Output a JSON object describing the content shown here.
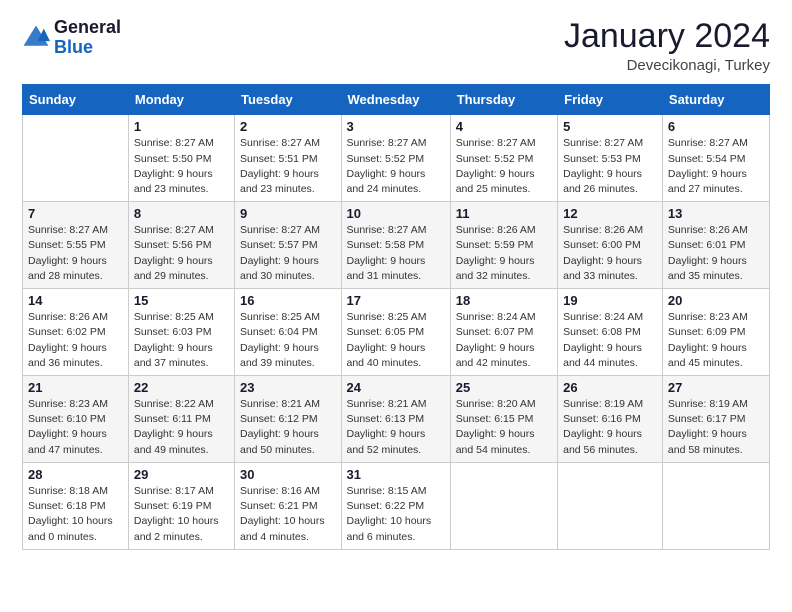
{
  "logo": {
    "general": "General",
    "blue": "Blue"
  },
  "title": "January 2024",
  "location": "Devecikonagi, Turkey",
  "weekdays": [
    "Sunday",
    "Monday",
    "Tuesday",
    "Wednesday",
    "Thursday",
    "Friday",
    "Saturday"
  ],
  "weeks": [
    [
      {
        "day": "",
        "sunrise": "",
        "sunset": "",
        "daylight": ""
      },
      {
        "day": "1",
        "sunrise": "Sunrise: 8:27 AM",
        "sunset": "Sunset: 5:50 PM",
        "daylight": "Daylight: 9 hours and 23 minutes."
      },
      {
        "day": "2",
        "sunrise": "Sunrise: 8:27 AM",
        "sunset": "Sunset: 5:51 PM",
        "daylight": "Daylight: 9 hours and 23 minutes."
      },
      {
        "day": "3",
        "sunrise": "Sunrise: 8:27 AM",
        "sunset": "Sunset: 5:52 PM",
        "daylight": "Daylight: 9 hours and 24 minutes."
      },
      {
        "day": "4",
        "sunrise": "Sunrise: 8:27 AM",
        "sunset": "Sunset: 5:52 PM",
        "daylight": "Daylight: 9 hours and 25 minutes."
      },
      {
        "day": "5",
        "sunrise": "Sunrise: 8:27 AM",
        "sunset": "Sunset: 5:53 PM",
        "daylight": "Daylight: 9 hours and 26 minutes."
      },
      {
        "day": "6",
        "sunrise": "Sunrise: 8:27 AM",
        "sunset": "Sunset: 5:54 PM",
        "daylight": "Daylight: 9 hours and 27 minutes."
      }
    ],
    [
      {
        "day": "7",
        "sunrise": "Sunrise: 8:27 AM",
        "sunset": "Sunset: 5:55 PM",
        "daylight": "Daylight: 9 hours and 28 minutes."
      },
      {
        "day": "8",
        "sunrise": "Sunrise: 8:27 AM",
        "sunset": "Sunset: 5:56 PM",
        "daylight": "Daylight: 9 hours and 29 minutes."
      },
      {
        "day": "9",
        "sunrise": "Sunrise: 8:27 AM",
        "sunset": "Sunset: 5:57 PM",
        "daylight": "Daylight: 9 hours and 30 minutes."
      },
      {
        "day": "10",
        "sunrise": "Sunrise: 8:27 AM",
        "sunset": "Sunset: 5:58 PM",
        "daylight": "Daylight: 9 hours and 31 minutes."
      },
      {
        "day": "11",
        "sunrise": "Sunrise: 8:26 AM",
        "sunset": "Sunset: 5:59 PM",
        "daylight": "Daylight: 9 hours and 32 minutes."
      },
      {
        "day": "12",
        "sunrise": "Sunrise: 8:26 AM",
        "sunset": "Sunset: 6:00 PM",
        "daylight": "Daylight: 9 hours and 33 minutes."
      },
      {
        "day": "13",
        "sunrise": "Sunrise: 8:26 AM",
        "sunset": "Sunset: 6:01 PM",
        "daylight": "Daylight: 9 hours and 35 minutes."
      }
    ],
    [
      {
        "day": "14",
        "sunrise": "Sunrise: 8:26 AM",
        "sunset": "Sunset: 6:02 PM",
        "daylight": "Daylight: 9 hours and 36 minutes."
      },
      {
        "day": "15",
        "sunrise": "Sunrise: 8:25 AM",
        "sunset": "Sunset: 6:03 PM",
        "daylight": "Daylight: 9 hours and 37 minutes."
      },
      {
        "day": "16",
        "sunrise": "Sunrise: 8:25 AM",
        "sunset": "Sunset: 6:04 PM",
        "daylight": "Daylight: 9 hours and 39 minutes."
      },
      {
        "day": "17",
        "sunrise": "Sunrise: 8:25 AM",
        "sunset": "Sunset: 6:05 PM",
        "daylight": "Daylight: 9 hours and 40 minutes."
      },
      {
        "day": "18",
        "sunrise": "Sunrise: 8:24 AM",
        "sunset": "Sunset: 6:07 PM",
        "daylight": "Daylight: 9 hours and 42 minutes."
      },
      {
        "day": "19",
        "sunrise": "Sunrise: 8:24 AM",
        "sunset": "Sunset: 6:08 PM",
        "daylight": "Daylight: 9 hours and 44 minutes."
      },
      {
        "day": "20",
        "sunrise": "Sunrise: 8:23 AM",
        "sunset": "Sunset: 6:09 PM",
        "daylight": "Daylight: 9 hours and 45 minutes."
      }
    ],
    [
      {
        "day": "21",
        "sunrise": "Sunrise: 8:23 AM",
        "sunset": "Sunset: 6:10 PM",
        "daylight": "Daylight: 9 hours and 47 minutes."
      },
      {
        "day": "22",
        "sunrise": "Sunrise: 8:22 AM",
        "sunset": "Sunset: 6:11 PM",
        "daylight": "Daylight: 9 hours and 49 minutes."
      },
      {
        "day": "23",
        "sunrise": "Sunrise: 8:21 AM",
        "sunset": "Sunset: 6:12 PM",
        "daylight": "Daylight: 9 hours and 50 minutes."
      },
      {
        "day": "24",
        "sunrise": "Sunrise: 8:21 AM",
        "sunset": "Sunset: 6:13 PM",
        "daylight": "Daylight: 9 hours and 52 minutes."
      },
      {
        "day": "25",
        "sunrise": "Sunrise: 8:20 AM",
        "sunset": "Sunset: 6:15 PM",
        "daylight": "Daylight: 9 hours and 54 minutes."
      },
      {
        "day": "26",
        "sunrise": "Sunrise: 8:19 AM",
        "sunset": "Sunset: 6:16 PM",
        "daylight": "Daylight: 9 hours and 56 minutes."
      },
      {
        "day": "27",
        "sunrise": "Sunrise: 8:19 AM",
        "sunset": "Sunset: 6:17 PM",
        "daylight": "Daylight: 9 hours and 58 minutes."
      }
    ],
    [
      {
        "day": "28",
        "sunrise": "Sunrise: 8:18 AM",
        "sunset": "Sunset: 6:18 PM",
        "daylight": "Daylight: 10 hours and 0 minutes."
      },
      {
        "day": "29",
        "sunrise": "Sunrise: 8:17 AM",
        "sunset": "Sunset: 6:19 PM",
        "daylight": "Daylight: 10 hours and 2 minutes."
      },
      {
        "day": "30",
        "sunrise": "Sunrise: 8:16 AM",
        "sunset": "Sunset: 6:21 PM",
        "daylight": "Daylight: 10 hours and 4 minutes."
      },
      {
        "day": "31",
        "sunrise": "Sunrise: 8:15 AM",
        "sunset": "Sunset: 6:22 PM",
        "daylight": "Daylight: 10 hours and 6 minutes."
      },
      {
        "day": "",
        "sunrise": "",
        "sunset": "",
        "daylight": ""
      },
      {
        "day": "",
        "sunrise": "",
        "sunset": "",
        "daylight": ""
      },
      {
        "day": "",
        "sunrise": "",
        "sunset": "",
        "daylight": ""
      }
    ]
  ]
}
